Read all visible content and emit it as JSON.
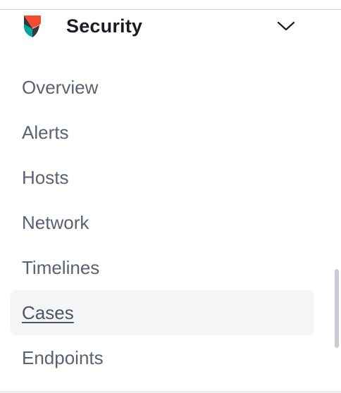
{
  "header": {
    "title": "Security",
    "logo_icon": "security-logo-icon",
    "toggle_icon": "chevron-down-icon"
  },
  "nav": {
    "items": [
      {
        "label": "Overview"
      },
      {
        "label": "Alerts"
      },
      {
        "label": "Hosts"
      },
      {
        "label": "Network"
      },
      {
        "label": "Timelines"
      },
      {
        "label": "Cases",
        "active": true
      },
      {
        "label": "Endpoints"
      }
    ]
  },
  "colors": {
    "logo_orange": "#f04e2f",
    "logo_teal": "#00a69b",
    "logo_dark": "#343741",
    "active_bg": "#f4f5f7",
    "text_muted": "#5a6170",
    "title": "#1a1c21"
  }
}
